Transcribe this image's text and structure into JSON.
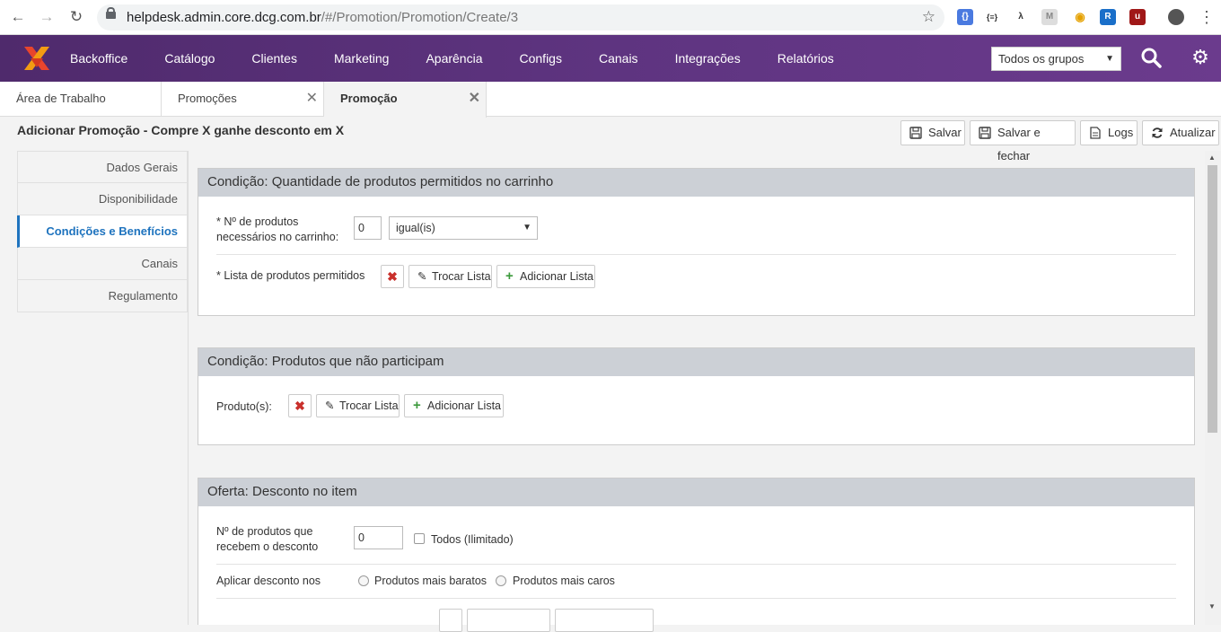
{
  "browser": {
    "url_host": "helpdesk.admin.core.dcg.com.br",
    "url_path": "/#/Promotion/Promotion/Create/3"
  },
  "header": {
    "menu": [
      "Backoffice",
      "Catálogo",
      "Clientes",
      "Marketing",
      "Aparência",
      "Configs",
      "Canais",
      "Integrações",
      "Relatórios"
    ],
    "group_select": "Todos os grupos"
  },
  "tabs": [
    {
      "label": "Área de Trabalho"
    },
    {
      "label": "Promoções"
    },
    {
      "label": "Promoção"
    }
  ],
  "page": {
    "title": "Adicionar Promoção - Compre X ganhe desconto em X",
    "buttons": {
      "save": "Salvar",
      "save_close": "Salvar e fechar",
      "logs": "Logs",
      "refresh": "Atualizar"
    }
  },
  "sidebar": {
    "items": [
      {
        "label": "Dados Gerais"
      },
      {
        "label": "Disponibilidade"
      },
      {
        "label": "Condições e Benefícios"
      },
      {
        "label": "Canais"
      },
      {
        "label": "Regulamento"
      }
    ]
  },
  "panels": {
    "p1": {
      "title": "Condição: Quantidade de produtos permitidos no carrinho",
      "qty_label_1": "* Nº de produtos",
      "qty_label_2": "necessários no carrinho:",
      "qty_value": "0",
      "operator": "igual(is)",
      "list_label": "* Lista de produtos permitidos",
      "swap": "Trocar Lista",
      "add": "Adicionar Lista"
    },
    "p2": {
      "title": "Condição: Produtos que não participam",
      "products_label": "Produto(s):",
      "swap": "Trocar Lista",
      "add": "Adicionar Lista"
    },
    "p3": {
      "title": "Oferta: Desconto no item",
      "qty_label_1": "Nº de produtos que",
      "qty_label_2": "recebem o desconto",
      "qty_value": "0",
      "all_label": "Todos (Ilimitado)",
      "apply_label": "Aplicar desconto nos",
      "cheap_label": "Produtos mais baratos",
      "expensive_label": "Produtos mais caros"
    }
  },
  "colors": {
    "header": "#5e3480",
    "accent": "#1e73be",
    "remove": "#c9302c",
    "add": "#3c9a3c"
  }
}
